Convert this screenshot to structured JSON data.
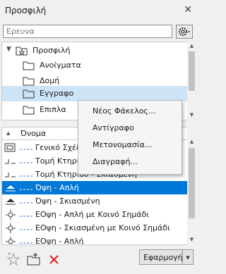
{
  "window": {
    "title": "Προσφιλή",
    "close_glyph": "✕"
  },
  "search": {
    "placeholder": "Ερευνα",
    "settings_icon": "gear-icon"
  },
  "tree": {
    "root_label": "Προσφιλή",
    "folders": [
      {
        "label": "Ανοίγματα",
        "selected": false
      },
      {
        "label": "Δομή",
        "selected": false
      },
      {
        "label": "Εγγραφο",
        "selected": true
      },
      {
        "label": "Επιπλα",
        "selected": false
      }
    ]
  },
  "context_menu": {
    "items": [
      "Νέος Φάκελος...",
      "Αντίγραφο",
      "Μετονομασία...",
      "Διαγραφή..."
    ]
  },
  "list": {
    "column_header": "Όνομα",
    "rows": [
      {
        "label": "Γενικό Σχέδ",
        "icon": "section-view-icon",
        "selected": false
      },
      {
        "label": "Τομή Κτηρίου",
        "icon": "section-icon",
        "selected": false
      },
      {
        "label": "Τομή Κτηρίου - Σκιασμένη",
        "icon": "section-icon",
        "selected": false
      },
      {
        "label": "Όψη - Απλή",
        "icon": "elevation-icon",
        "selected": true
      },
      {
        "label": "Όψη - Σκιασμένη",
        "icon": "elevation-icon",
        "selected": false
      },
      {
        "label": "ΕΟψη - Απλή με Κοινό Σημάδι",
        "icon": "interior-elevation-icon",
        "selected": false
      },
      {
        "label": "ΕΟψη - Σκιασμένη με Κοινό Σημάδι",
        "icon": "interior-elevation-icon",
        "selected": false
      },
      {
        "label": "ΕΟψη - Απλή",
        "icon": "interior-elevation-icon",
        "selected": false
      }
    ]
  },
  "footer": {
    "apply_label": "Εφαρμογή"
  },
  "colors": {
    "selection": "#0078d7",
    "tree_selection": "#cde4f7",
    "delete": "#e02020"
  }
}
